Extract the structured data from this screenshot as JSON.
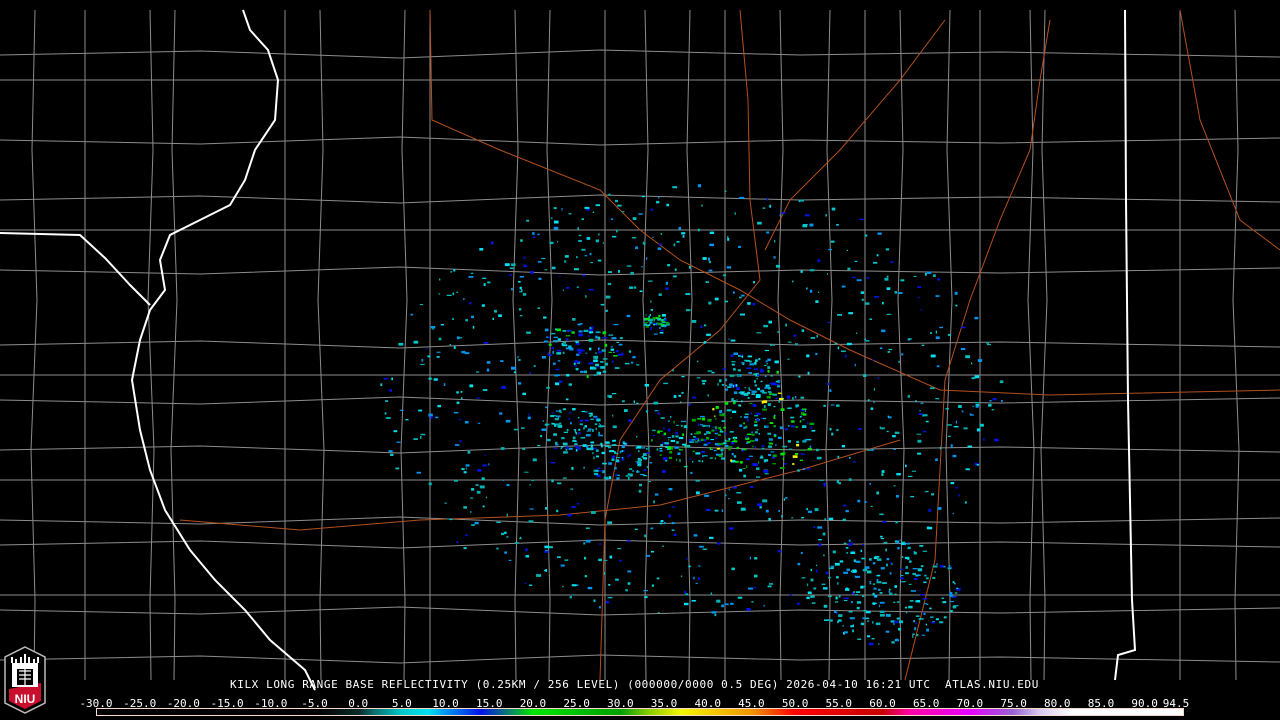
{
  "header": {
    "title": "KILX LONG RANGE BASE REFLECTIVITY (0.25KM / 256 LEVEL) (000000/0000 0.5 DEG) 2026-04-10 16:21 UTC  ATLAS.NIU.EDU"
  },
  "logo": {
    "text": "NIU"
  },
  "scale": {
    "labels": [
      "-30.0",
      "-25.0",
      "-20.0",
      "-15.0",
      "-10.0",
      "-5.0",
      "0.0",
      "5.0",
      "10.0",
      "15.0",
      "20.0",
      "25.0",
      "30.0",
      "35.0",
      "40.0",
      "45.0",
      "50.0",
      "55.0",
      "60.0",
      "65.0",
      "70.0",
      "75.0",
      "80.0",
      "85.0",
      "90.0",
      "94.5"
    ],
    "stops": [
      {
        "dbz": -30,
        "color": "#000000"
      },
      {
        "dbz": -5,
        "color": "#000000"
      },
      {
        "dbz": 0,
        "color": "#0a2a2a"
      },
      {
        "dbz": 2,
        "color": "#0a7878"
      },
      {
        "dbz": 5,
        "color": "#00c8c8"
      },
      {
        "dbz": 8,
        "color": "#00e0f0"
      },
      {
        "dbz": 10,
        "color": "#0096f0"
      },
      {
        "dbz": 14,
        "color": "#0014e6"
      },
      {
        "dbz": 17,
        "color": "#0a7878"
      },
      {
        "dbz": 20,
        "color": "#00e600"
      },
      {
        "dbz": 30,
        "color": "#00a000"
      },
      {
        "dbz": 33,
        "color": "#80c800"
      },
      {
        "dbz": 37,
        "color": "#f5f500"
      },
      {
        "dbz": 45,
        "color": "#f09600"
      },
      {
        "dbz": 50,
        "color": "#ff0000"
      },
      {
        "dbz": 60,
        "color": "#c80000"
      },
      {
        "dbz": 63,
        "color": "#ff00a0"
      },
      {
        "dbz": 70,
        "color": "#e600ff"
      },
      {
        "dbz": 75,
        "color": "#9664d2"
      },
      {
        "dbz": 78,
        "color": "#d7c8f0"
      },
      {
        "dbz": 82,
        "color": "#ffffff"
      },
      {
        "dbz": 94.5,
        "color": "#ffffff"
      }
    ]
  },
  "colors": {
    "state": "#ffffff",
    "county": "#8c8c8c",
    "road": "#b4501e",
    "niu_red": "#c8102e"
  },
  "radar": {
    "site": "KILX"
  }
}
